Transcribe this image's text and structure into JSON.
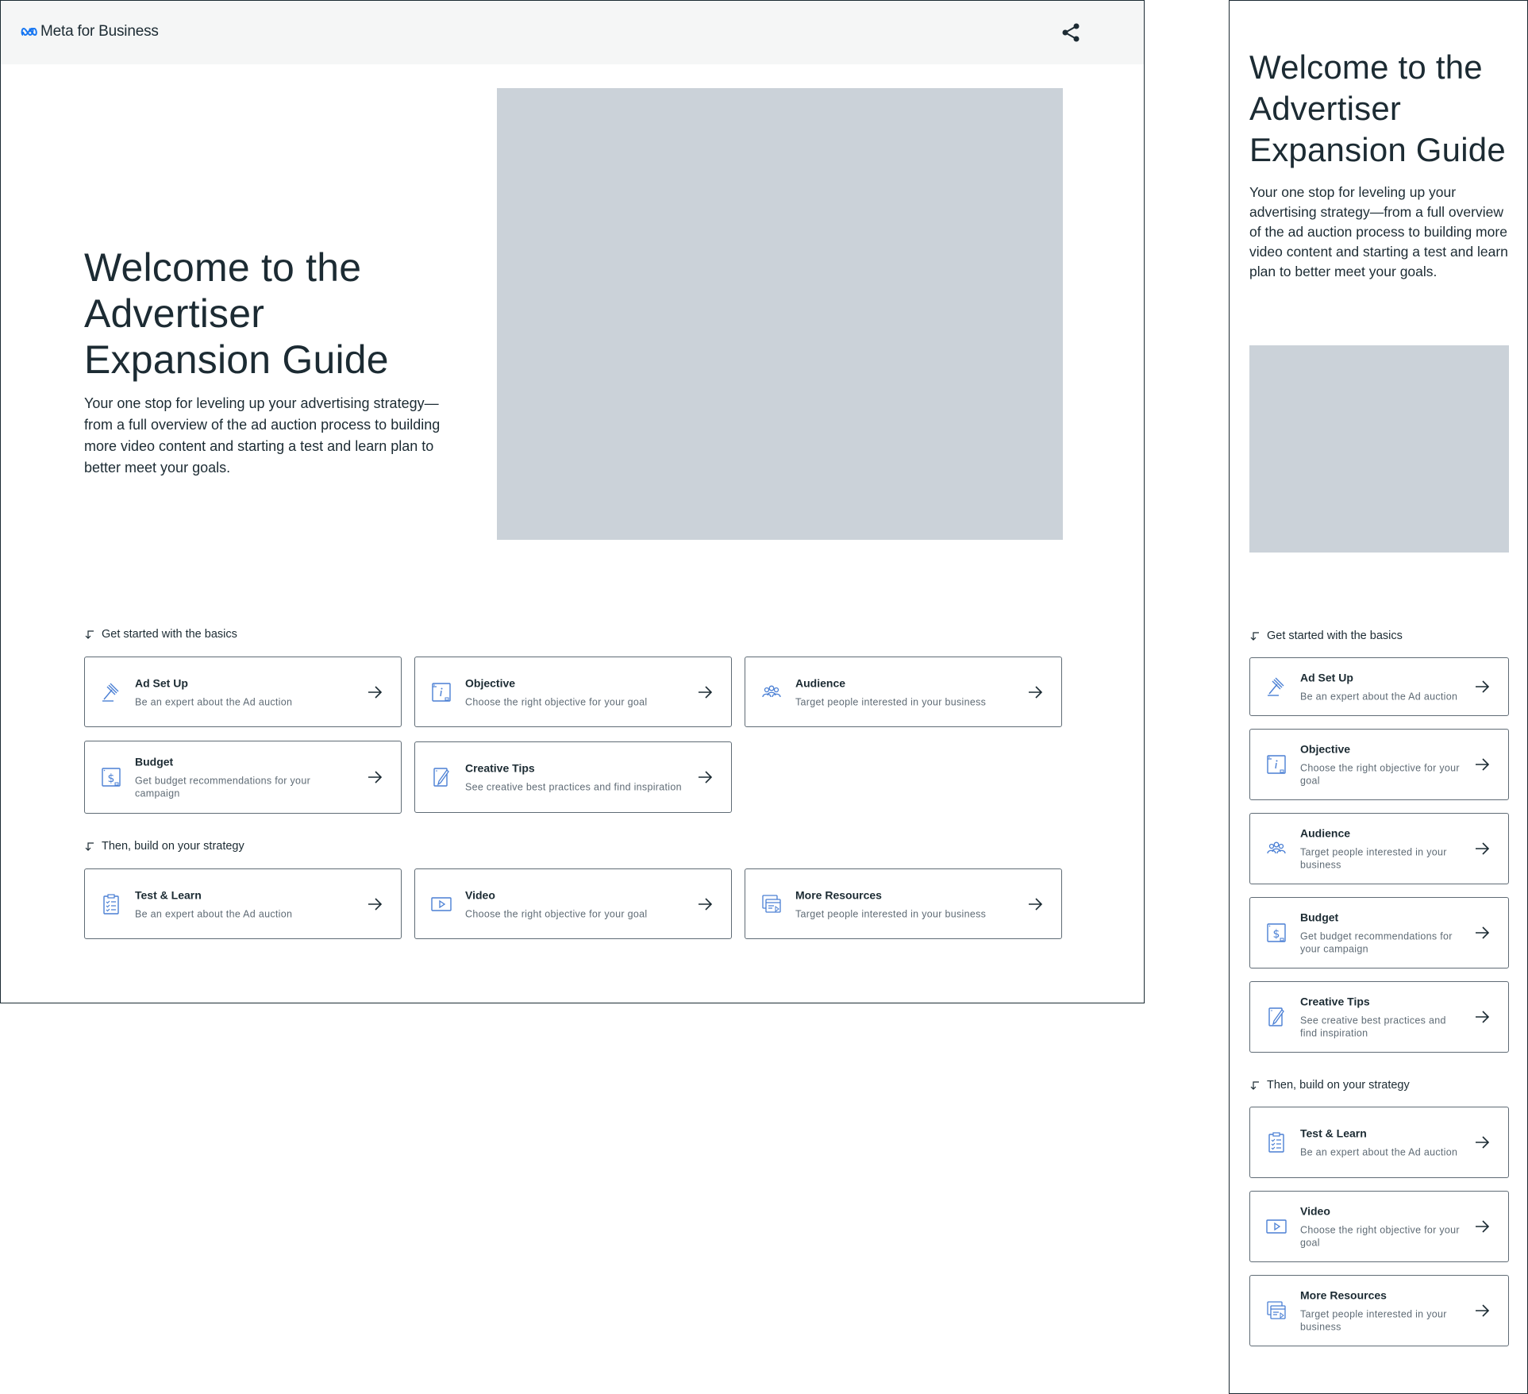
{
  "brand": {
    "name": "Meta for Business"
  },
  "hero": {
    "title": "Welcome to the Advertiser Expansion Guide",
    "title_lines": [
      "Welcome to the",
      "Advertiser",
      "Expansion Guide"
    ],
    "description": "Your one stop for leveling up your advertising strategy—from a full overview of the ad auction process to building more video content and starting a test and learn plan to better meet your goals."
  },
  "sections": {
    "basics": {
      "label": "Get started with the basics",
      "cards": [
        {
          "icon": "gavel-icon",
          "title": "Ad Set Up",
          "desc": "Be an expert about the Ad auction"
        },
        {
          "icon": "info-window-icon",
          "title": "Objective",
          "desc": "Choose the right objective for your goal"
        },
        {
          "icon": "people-icon",
          "title": "Audience",
          "desc": "Target people interested in your business"
        },
        {
          "icon": "dollar-document-icon",
          "title": "Budget",
          "desc": "Get budget recommendations for your campaign"
        },
        {
          "icon": "pencil-document-icon",
          "title": "Creative Tips",
          "desc": "See creative best practices and find inspiration"
        }
      ]
    },
    "strategy": {
      "label": "Then, build on your strategy",
      "cards": [
        {
          "icon": "clipboard-checklist-icon",
          "title": "Test & Learn",
          "desc": "Be an expert about the Ad auction"
        },
        {
          "icon": "play-video-icon",
          "title": "Video",
          "desc": "Choose the right objective for your goal"
        },
        {
          "icon": "resources-icon",
          "title": "More Resources",
          "desc": "Target people interested in your business"
        }
      ]
    }
  },
  "colors": {
    "text": "#1c2b33",
    "secondary": "#5f6b75",
    "accent": "#1877f2",
    "placeholder": "#cbd2d9",
    "header_bg": "#f5f6f6"
  }
}
